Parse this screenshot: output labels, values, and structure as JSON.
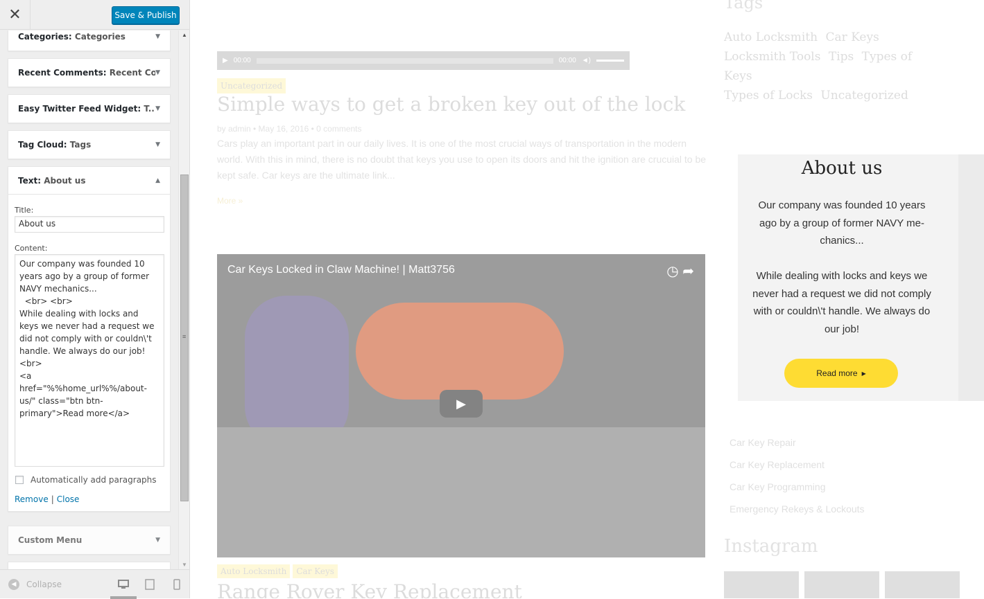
{
  "customizer": {
    "close_icon": "close-icon",
    "save_label": "Save & Publish",
    "widgets": [
      {
        "type": "Categories:",
        "title": "Categories"
      },
      {
        "type": "Recent Comments:",
        "title": "Recent Co..."
      },
      {
        "type": "Easy Twitter Feed Widget:",
        "title": "T..."
      },
      {
        "type": "Tag Cloud:",
        "title": "Tags"
      },
      {
        "type": "Text:",
        "title": "About us"
      }
    ],
    "text_widget": {
      "title_label": "Title:",
      "title_value": "About us",
      "content_label": "Content:",
      "content_value": "Our company was founded 10 years ago by a group of former NAVY mechanics...\n  <br> <br>\nWhile dealing with locks and keys we never had a request we did not comply with or couldn\\'t handle. We always do our job!\n<br>\n<a href=\"%%home_url%%/about-us/\" class=\"btn btn-primary\">Read more</a>",
      "autop_label": "Automatically add paragraphs",
      "remove_label": "Remove",
      "separator": "|",
      "close_label": "Close"
    },
    "custom_menu_label": "Custom Menu",
    "footer": {
      "collapse_label": "Collapse",
      "devices": [
        "desktop-icon",
        "tablet-icon",
        "mobile-icon"
      ]
    }
  },
  "preview": {
    "audio": {
      "time_start": "00:00",
      "time_end": "00:00"
    },
    "post1": {
      "category": "Uncategorized",
      "title": "Simple ways to get a broken key out of the lock",
      "meta": "by admin  •  May 16, 2016  •  0 comments",
      "excerpt": "Cars play an important part in our daily lives. It is one of the most crucial ways of transportation in the modern world. With this in mind, there is no doubt that keys you use to open its doors and hit the ignition are crucuial to be kept safe. Car keys are the ultimate link...",
      "more": "More »"
    },
    "video": {
      "title": "Car Keys Locked in Claw Machine! | Matt3756"
    },
    "post2": {
      "categories": [
        "Auto Locksmith",
        "Car Keys"
      ],
      "title": "Range Rover Key Replacement"
    },
    "sidebar": {
      "tags_heading": "Tags",
      "tags": [
        "Auto Locksmith",
        "Car Keys",
        "Locksmith Tools",
        "Tips",
        "Types of Keys",
        "Types of Locks",
        "Uncategorized"
      ],
      "about": {
        "heading": "About us",
        "para1": "Our company was founded 10 years ago by a group of former NAVY me­chanics...",
        "para2": "While dealing with locks and keys we never had a request we did not com­ply with or couldn\\'t handle. We al­ways do our job!",
        "button": "Read more"
      },
      "menu": [
        "Car Key Repair",
        "Car Key Replacement",
        "Car Key Programming",
        "Emergency Rekeys & Lockouts"
      ],
      "instagram_heading": "Instagram"
    }
  }
}
